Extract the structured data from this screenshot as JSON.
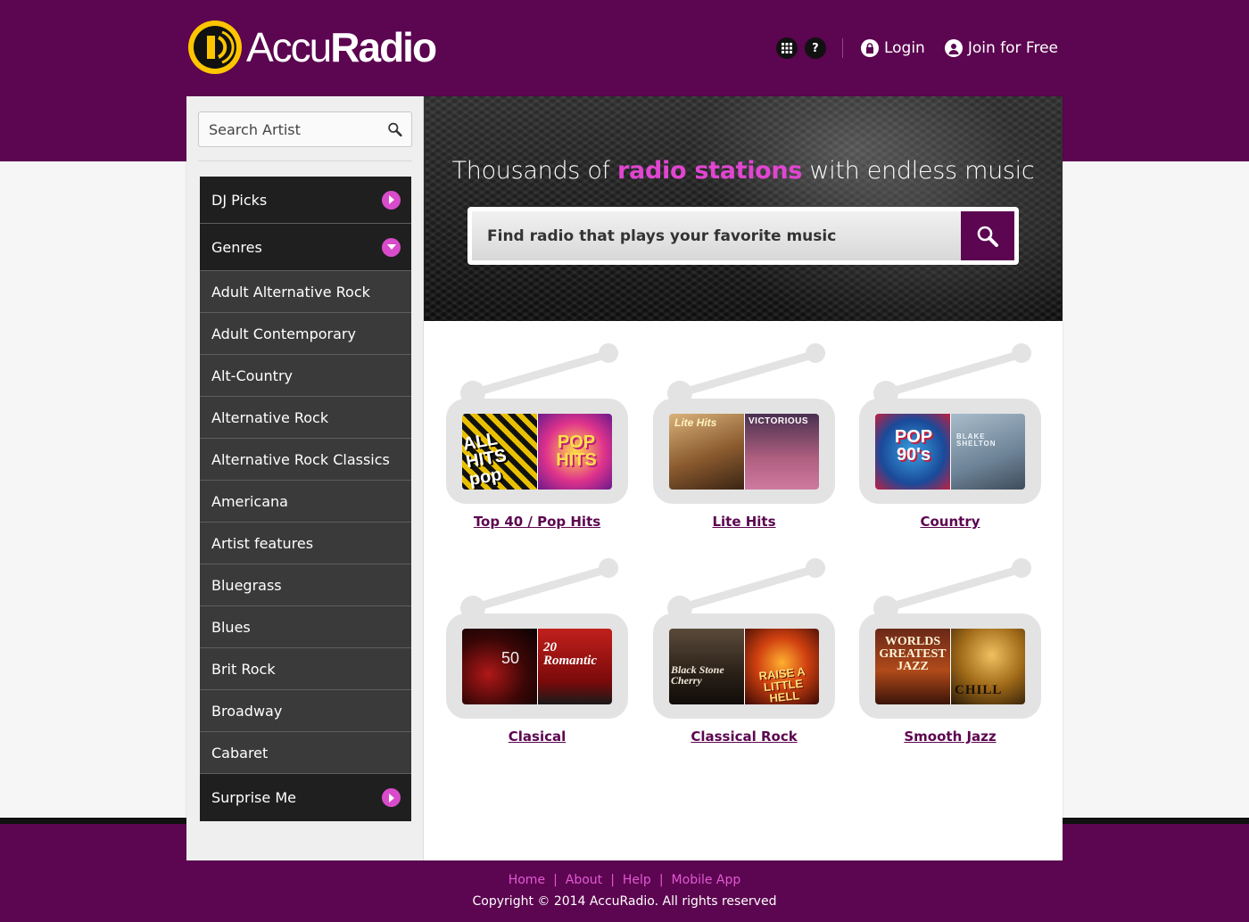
{
  "brand": {
    "name_light": "Accu",
    "name_bold": "Radio",
    "yellow": "#ffc600",
    "purple": "#5c0550",
    "pink": "#e046d0"
  },
  "header": {
    "apps_icon": "grid-icon",
    "help_glyph": "?",
    "login_label": "Login",
    "join_label": "Join for Free"
  },
  "sidebar": {
    "search_placeholder": "Search Artist",
    "dj_picks_label": "DJ Picks",
    "genres_label": "Genres",
    "genres": [
      "Adult Alternative Rock",
      "Adult Contemporary",
      "Alt-Country",
      "Alternative Rock",
      "Alternative Rock Classics",
      "Americana",
      "Artist features",
      "Bluegrass",
      "Blues",
      "Brit Rock",
      "Broadway",
      "Cabaret"
    ],
    "surprise_label": "Surprise Me"
  },
  "hero": {
    "title_pre": "Thousands of ",
    "title_highlight": "radio stations",
    "title_post": " with endless music",
    "search_placeholder": "Find radio that plays your favorite music"
  },
  "tiles": [
    {
      "label": "Top 40 / Pop Hits",
      "covers": [
        "ALL HITS pop",
        "POP HITS"
      ]
    },
    {
      "label": "Lite Hits",
      "covers": [
        "Lite Hits",
        "VICTORIOUS"
      ]
    },
    {
      "label": "Country",
      "covers": [
        "POP 90's",
        "BLAKE SHELTON"
      ]
    },
    {
      "label": "Clasical",
      "covers": [
        "50",
        "20 Romantic"
      ]
    },
    {
      "label": "Classical Rock",
      "covers": [
        "Black Stone Cherry",
        "RAISE A LITTLE HELL"
      ]
    },
    {
      "label": "Smooth Jazz",
      "covers": [
        "WORLDS GREATEST JAZZ",
        "CHILL"
      ]
    }
  ],
  "footer": {
    "links": [
      "Home",
      "About",
      "Help",
      "Mobile App"
    ],
    "separator": "|",
    "copyright": "Copyright © 2014 AccuRadio. All rights reserved"
  }
}
